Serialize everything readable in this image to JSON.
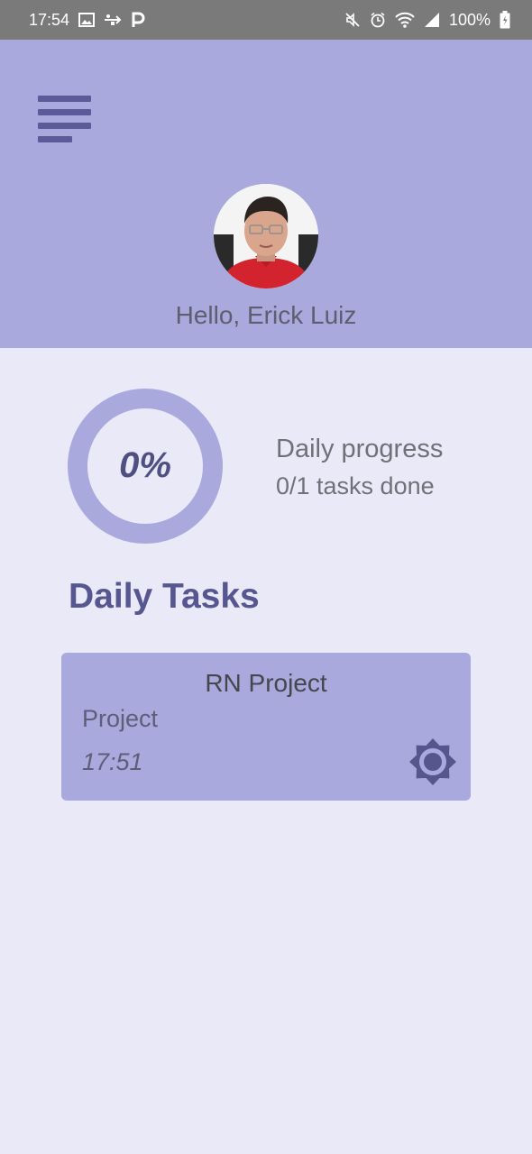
{
  "status_bar": {
    "time": "17:54",
    "battery": "100%",
    "icons": [
      "image-icon",
      "usb-icon",
      "parking-icon",
      "mute-icon",
      "alarm-icon",
      "wifi-icon",
      "signal-icon",
      "battery-icon"
    ]
  },
  "header": {
    "menu_icon": "menu-icon",
    "greeting": "Hello, Erick Luiz"
  },
  "progress": {
    "percent_label": "0%",
    "value": 0,
    "title": "Daily progress",
    "subtitle": "0/1 tasks done"
  },
  "tasks_section": {
    "title": "Daily Tasks",
    "tasks": [
      {
        "title": "RN Project",
        "type": "Project",
        "time": "17:51",
        "icon": "settings-icon"
      }
    ]
  },
  "colors": {
    "header_bg": "#A9A9DD",
    "page_bg": "#EAE9F8",
    "accent_dark": "#565690",
    "ring": "#A9A9DD"
  }
}
